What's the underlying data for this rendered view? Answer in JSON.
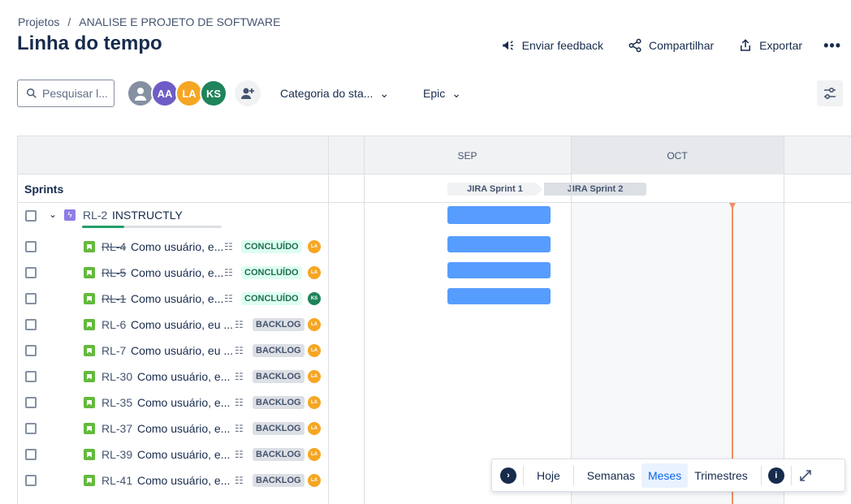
{
  "breadcrumb": {
    "project": "Projetos",
    "sep": "/",
    "current": "ANALISE E PROJETO DE SOFTWARE"
  },
  "page": {
    "title": "Linha do tempo"
  },
  "header_actions": {
    "feedback": "Enviar feedback",
    "share": "Compartilhar",
    "export": "Exportar",
    "more": "•••"
  },
  "toolbar": {
    "search_placeholder": "Pesquisar l...",
    "avatars": [
      {
        "initials": "",
        "color": "#8590a2"
      },
      {
        "initials": "AA",
        "color": "#6e5dc6"
      },
      {
        "initials": "LA",
        "color": "#f5a623"
      },
      {
        "initials": "KS",
        "color": "#1f845a"
      }
    ],
    "status_filter": "Categoria do sta...",
    "epic_filter": "Epic"
  },
  "timeline": {
    "months": [
      "SEP",
      "OCT"
    ],
    "sprints_label": "Sprints",
    "sprints": [
      "JIRA Sprint 1",
      "JIRA Sprint 2"
    ],
    "epic": {
      "key": "RL-2",
      "summary": "INSTRUCTLY",
      "progress": 0.3
    },
    "issues": [
      {
        "key": "RL-4",
        "summary": "Como usuário, e...",
        "status": "CONCLUÍDO",
        "assignee": "LA",
        "done": true,
        "bar": true
      },
      {
        "key": "RL-5",
        "summary": "Como usuário, e...",
        "status": "CONCLUÍDO",
        "assignee": "LA",
        "done": true,
        "bar": true
      },
      {
        "key": "RL-1",
        "summary": "Como usuário, e...",
        "status": "CONCLUÍDO",
        "assignee": "KS",
        "done": true,
        "bar": true
      },
      {
        "key": "RL-6",
        "summary": "Como usuário, eu ...",
        "status": "BACKLOG",
        "assignee": "LA",
        "done": false,
        "bar": false
      },
      {
        "key": "RL-7",
        "summary": "Como usuário, eu ...",
        "status": "BACKLOG",
        "assignee": "LA",
        "done": false,
        "bar": false
      },
      {
        "key": "RL-30",
        "summary": "Como usuário, e...",
        "status": "BACKLOG",
        "assignee": "LA",
        "done": false,
        "bar": false
      },
      {
        "key": "RL-35",
        "summary": "Como usuário, e...",
        "status": "BACKLOG",
        "assignee": "LA",
        "done": false,
        "bar": false
      },
      {
        "key": "RL-37",
        "summary": "Como usuário, e...",
        "status": "BACKLOG",
        "assignee": "LA",
        "done": false,
        "bar": false
      },
      {
        "key": "RL-39",
        "summary": "Como usuário, e...",
        "status": "BACKLOG",
        "assignee": "LA",
        "done": false,
        "bar": false
      },
      {
        "key": "RL-41",
        "summary": "Como usuário, e...",
        "status": "BACKLOG",
        "assignee": "LA",
        "done": false,
        "bar": false
      }
    ]
  },
  "zoom": {
    "today": "Hoje",
    "weeks": "Semanas",
    "months": "Meses",
    "quarters": "Trimestres",
    "active": "Meses"
  },
  "colors": {
    "done_bar": "#579dff",
    "today_line": "#f18d61",
    "accent": "#0c66e4",
    "la": "#f5a623",
    "ks": "#1f845a"
  }
}
